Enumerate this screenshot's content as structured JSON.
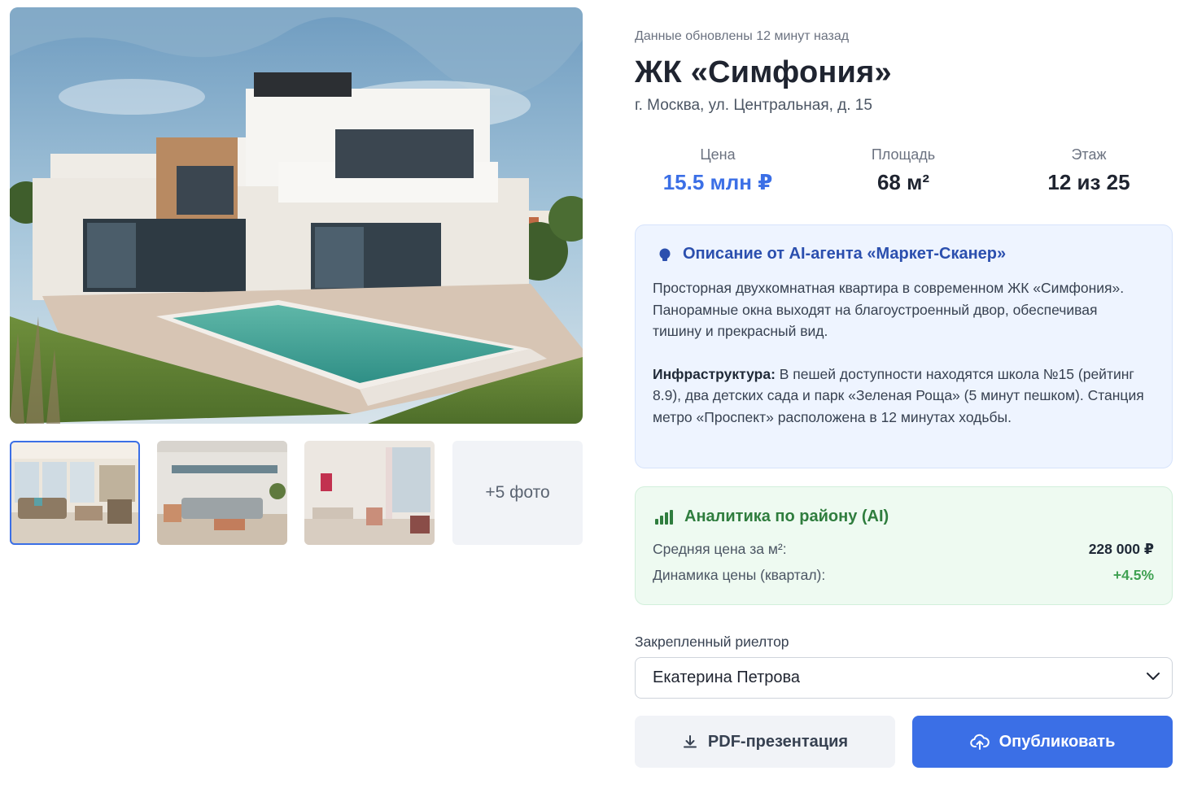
{
  "gallery": {
    "main_photo_alt": "modern-villa-with-pool",
    "more_photos_label": "+5 фото",
    "thumbnails": [
      "living-room-1",
      "living-room-2",
      "bedroom"
    ]
  },
  "listing": {
    "updated_text": "Данные обновлены 12 минут назад",
    "title": "ЖК «Симфония»",
    "address": "г. Москва, ул. Центральная, д. 15"
  },
  "stats": {
    "price_label": "Цена",
    "price_value": "15.5 млн ₽",
    "area_label": "Площадь",
    "area_value": "68 м²",
    "floor_label": "Этаж",
    "floor_value": "12 из 25"
  },
  "ai_description": {
    "icon": "lightbulb-icon",
    "title": "Описание от AI-агента «Маркет-Сканер»",
    "paragraph1": "Просторная двухкомнатная квартира в современном ЖК «Симфония». Панорамные окна выходят на благоустроенный двор, обеспечивая тишину и прекрасный вид.",
    "infra_label": "Инфраструктура:",
    "infra_text": " В пешей доступности находятся школа №15 (рейтинг 8.9), два детских сада и парк «Зеленая Роща» (5 минут пешком). Станция метро «Проспект» расположена в 12 минутах ходьбы."
  },
  "analytics": {
    "icon": "bar-chart-icon",
    "title": "Аналитика по району (AI)",
    "rows": [
      {
        "label": "Средняя цена за м²:",
        "value": "228 000 ₽"
      },
      {
        "label": "Динамика цены (квартал):",
        "value": "+4.5%"
      }
    ]
  },
  "realtor": {
    "label": "Закрепленный риелтор",
    "selected": "Екатерина Петрова"
  },
  "actions": {
    "pdf_label": "PDF-презентация",
    "publish_label": "Опубликовать"
  },
  "colors": {
    "accent": "#3b6fe6",
    "ai_card_bg": "#eef4ff",
    "analytics_bg": "#eefaf1",
    "positive": "#3fa152"
  }
}
